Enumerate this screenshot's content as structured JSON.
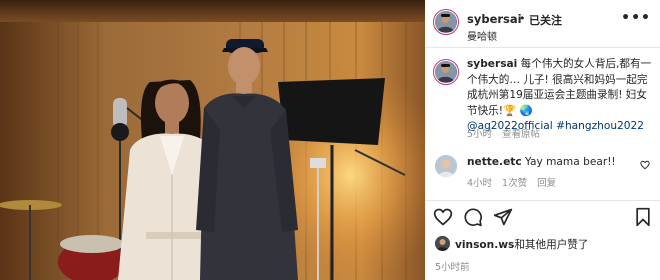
{
  "colors": {
    "link": "#00376b",
    "muted": "#8e8e8e",
    "text": "#262626",
    "story_ring": "#c0387e"
  },
  "post": {
    "photo_alt": "photo",
    "header": {
      "username": "sybersai",
      "separator": "•",
      "follow_status": "已关注",
      "location": "曼哈顿",
      "more_icon": "more-horizontal-icon"
    },
    "caption": {
      "username": "sybersai",
      "body": "每个伟大的女人背后,都有一个伟大的… 儿子! 很高兴和妈妈一起完成杭州第19届亚运会主题曲录制! 妇女节快乐!🏆 🌏",
      "tags": "@ag2022official #hangzhou2022",
      "time": "5小时",
      "translate": "查看原帖"
    },
    "comment": {
      "username": "nette.etc",
      "body": "Yay mama bear!!",
      "time": "4小时",
      "likes": "1次赞",
      "reply": "回复"
    },
    "actions": {
      "like_icon": "heart-icon",
      "comment_icon": "comment-icon",
      "share_icon": "send-icon",
      "save_icon": "bookmark-icon"
    },
    "likes": {
      "username": "vinson.ws",
      "rest": "和其他用户赞了"
    },
    "timestamp": "5小时前"
  }
}
